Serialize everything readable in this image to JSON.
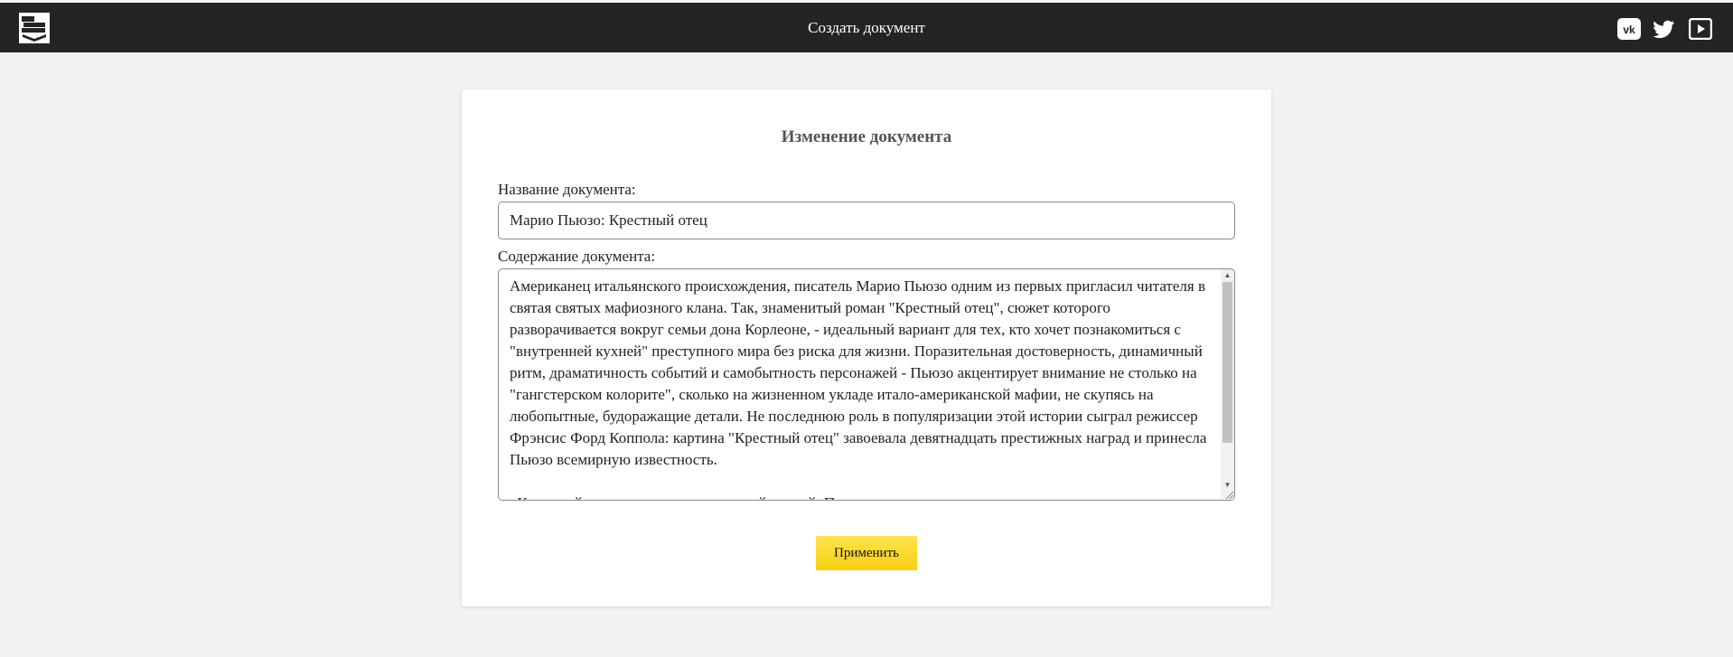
{
  "header": {
    "title": "Создать документ",
    "logo_icon": "books-logo-icon",
    "social": [
      {
        "name": "vk-icon"
      },
      {
        "name": "twitter-icon"
      },
      {
        "name": "youtube-icon"
      }
    ]
  },
  "form": {
    "heading": "Изменение документа",
    "name_label": "Название документа:",
    "name_value": "Марио Пьюзо: Крестный отец",
    "content_label": "Содержание документа:",
    "content_value": "Американец итальянского происхождения, писатель Марио Пьюзо одним из первых пригласил читателя в святая святых мафиозного клана. Так, знаменитый роман \"Крестный отец\", сюжет которого разворачивается вокруг семьи дона Корлеоне, - идеальный вариант для тех, кто хочет познакомиться с \"внутренней кухней\" преступного мира без риска для жизни. Поразительная достоверность, динамичный ритм, драматичность событий и самобытность персонажей - Пьюзо акцентирует внимание не столько на \"гангстерском колорите\", сколько на жизненном укладе итало-американской мафии, не скупясь на любопытные, будоражащие детали. Не последнюю роль в популяризации этой истории сыграл режиссер Фрэнсис Форд Коппола: картина \"Крестный отец\" завоевала девятнадцать престижных наград и принесла Пьюзо всемирную известность.\n\n«Крестный отец» давно стал культовой книгой. Пьюзо увлекательно и достоверно описал жизнь одного из",
    "submit_label": "Применить"
  },
  "colors": {
    "topbar": "#242424",
    "background": "#f2f2f2",
    "button": "#f7cf0f"
  }
}
